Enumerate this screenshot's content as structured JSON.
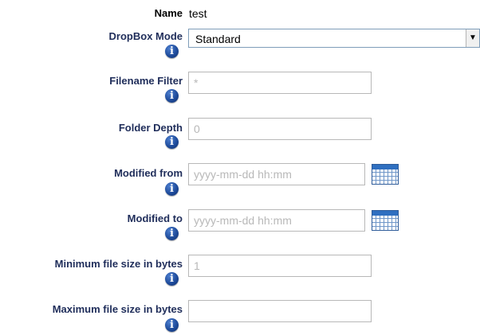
{
  "name_row": {
    "label": "Name",
    "value": "test"
  },
  "dropbox_mode": {
    "label": "DropBox Mode",
    "selected": "Standard"
  },
  "filename_filter": {
    "label": "Filename Filter",
    "placeholder": "*"
  },
  "folder_depth": {
    "label": "Folder Depth",
    "placeholder": "0"
  },
  "modified_from": {
    "label": "Modified from",
    "placeholder": "yyyy-mm-dd hh:mm"
  },
  "modified_to": {
    "label": "Modified to",
    "placeholder": "yyyy-mm-dd hh:mm"
  },
  "min_size": {
    "label": "Minimum file size in bytes",
    "placeholder": "1"
  },
  "max_size": {
    "label": "Maximum file size in bytes",
    "placeholder": ""
  },
  "icons": {
    "info": "info-icon",
    "info_glyph": "i",
    "calendar": "calendar-icon",
    "dropdown": "chevron-down-icon",
    "dropdown_glyph": "▼"
  },
  "colors": {
    "label_text": "#1f2d5a",
    "info_icon": "#1f4c9c",
    "input_border": "#b8b8b8",
    "placeholder": "#b8b8b8"
  }
}
